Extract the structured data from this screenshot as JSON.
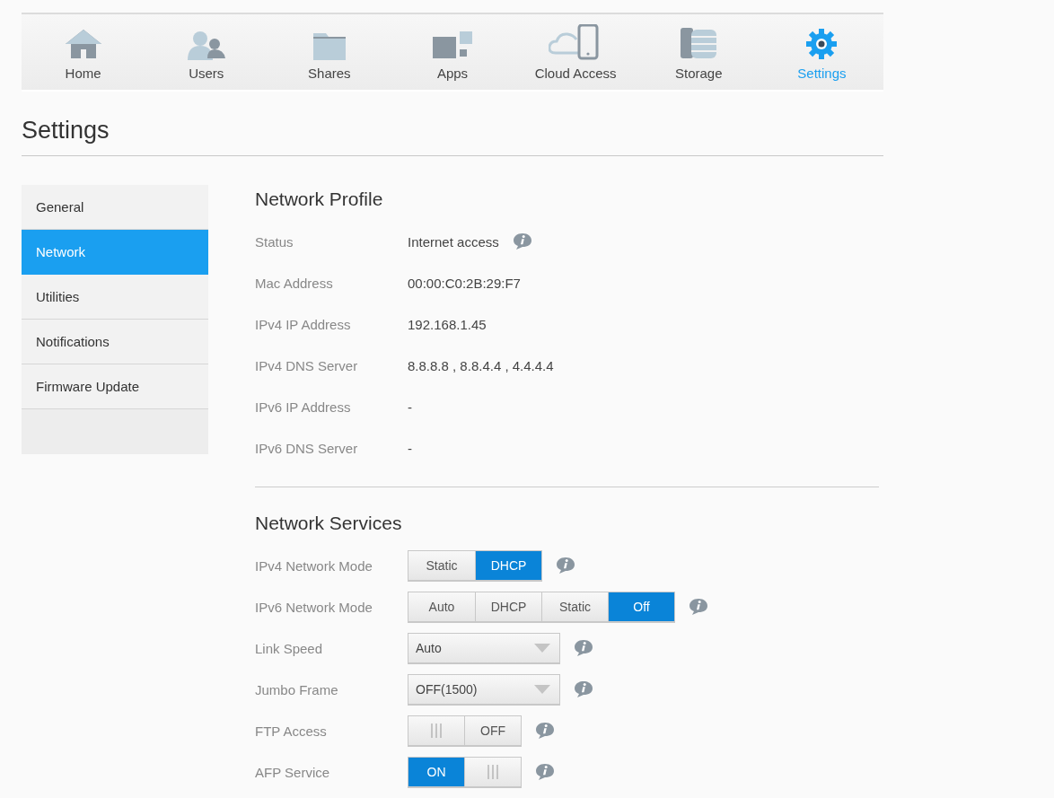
{
  "nav": [
    {
      "label": "Home",
      "selected": false
    },
    {
      "label": "Users",
      "selected": false
    },
    {
      "label": "Shares",
      "selected": false
    },
    {
      "label": "Apps",
      "selected": false
    },
    {
      "label": "Cloud Access",
      "selected": false
    },
    {
      "label": "Storage",
      "selected": false
    },
    {
      "label": "Settings",
      "selected": true
    }
  ],
  "page_title": "Settings",
  "sidebar": {
    "items": [
      {
        "label": "General",
        "selected": false
      },
      {
        "label": "Network",
        "selected": true
      },
      {
        "label": "Utilities",
        "selected": false
      },
      {
        "label": "Notifications",
        "selected": false
      },
      {
        "label": "Firmware Update",
        "selected": false
      }
    ]
  },
  "network_profile": {
    "title": "Network Profile",
    "rows": [
      {
        "label": "Status",
        "value": "Internet access",
        "info": true
      },
      {
        "label": "Mac Address",
        "value": "00:00:C0:2B:29:F7",
        "info": false
      },
      {
        "label": "IPv4 IP Address",
        "value": "192.168.1.45",
        "info": false
      },
      {
        "label": "IPv4 DNS Server",
        "value": "8.8.8.8 , 8.8.4.4 , 4.4.4.4",
        "info": false
      },
      {
        "label": "IPv6 IP Address",
        "value": "-",
        "info": false
      },
      {
        "label": "IPv6 DNS Server",
        "value": "-",
        "info": false
      }
    ]
  },
  "network_services": {
    "title": "Network Services",
    "rows": [
      {
        "kind": "segmented",
        "label": "IPv4 Network Mode",
        "options": [
          {
            "label": "Static",
            "selected": false
          },
          {
            "label": "DHCP",
            "selected": true
          }
        ]
      },
      {
        "kind": "segmented",
        "label": "IPv6 Network Mode",
        "options": [
          {
            "label": "Auto",
            "selected": false
          },
          {
            "label": "DHCP",
            "selected": false
          },
          {
            "label": "Static",
            "selected": false
          },
          {
            "label": "Off",
            "selected": true
          }
        ]
      },
      {
        "kind": "select",
        "label": "Link Speed",
        "value": "Auto"
      },
      {
        "kind": "select",
        "label": "Jumbo Frame",
        "value": "OFF(1500)"
      },
      {
        "kind": "toggle",
        "label": "FTP Access",
        "on": false,
        "state_text": "OFF"
      },
      {
        "kind": "toggle",
        "label": "AFP Service",
        "on": true,
        "state_text": "ON"
      }
    ]
  }
}
